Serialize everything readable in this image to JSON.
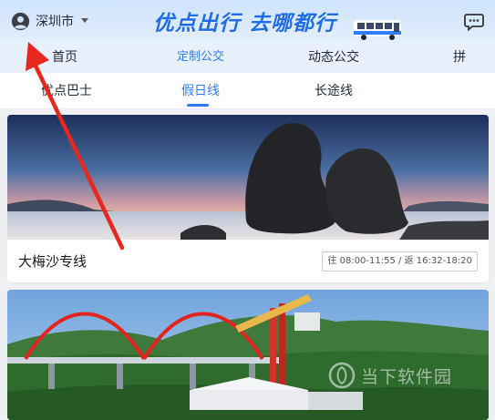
{
  "header": {
    "city": "深圳市",
    "slogan": "优点出行 去哪都行",
    "icons": {
      "avatar": "user-circle-icon",
      "caret": "caret-down-icon",
      "chat": "chat-bubble-icon",
      "bus": "bus-illustration"
    }
  },
  "main_tabs": [
    {
      "label": "首页",
      "active": false
    },
    {
      "label": "定制公交",
      "active": true
    },
    {
      "label": "动态公交",
      "active": false
    },
    {
      "label": "拼",
      "active": false
    }
  ],
  "sub_tabs": [
    {
      "label": "优点巴士",
      "active": false
    },
    {
      "label": "假日线",
      "active": true
    },
    {
      "label": "长途线",
      "active": false
    }
  ],
  "routes": [
    {
      "title": "大梅沙专线",
      "time": "往 08:00-11:55 / 返 16:32-18:20"
    }
  ],
  "watermark": {
    "text": "当下软件园"
  },
  "colors": {
    "accent": "#2f7df6",
    "slogan": "#1e6ce6",
    "header_bg": "#cfe3fb",
    "annotation_arrow": "#e8271f"
  }
}
